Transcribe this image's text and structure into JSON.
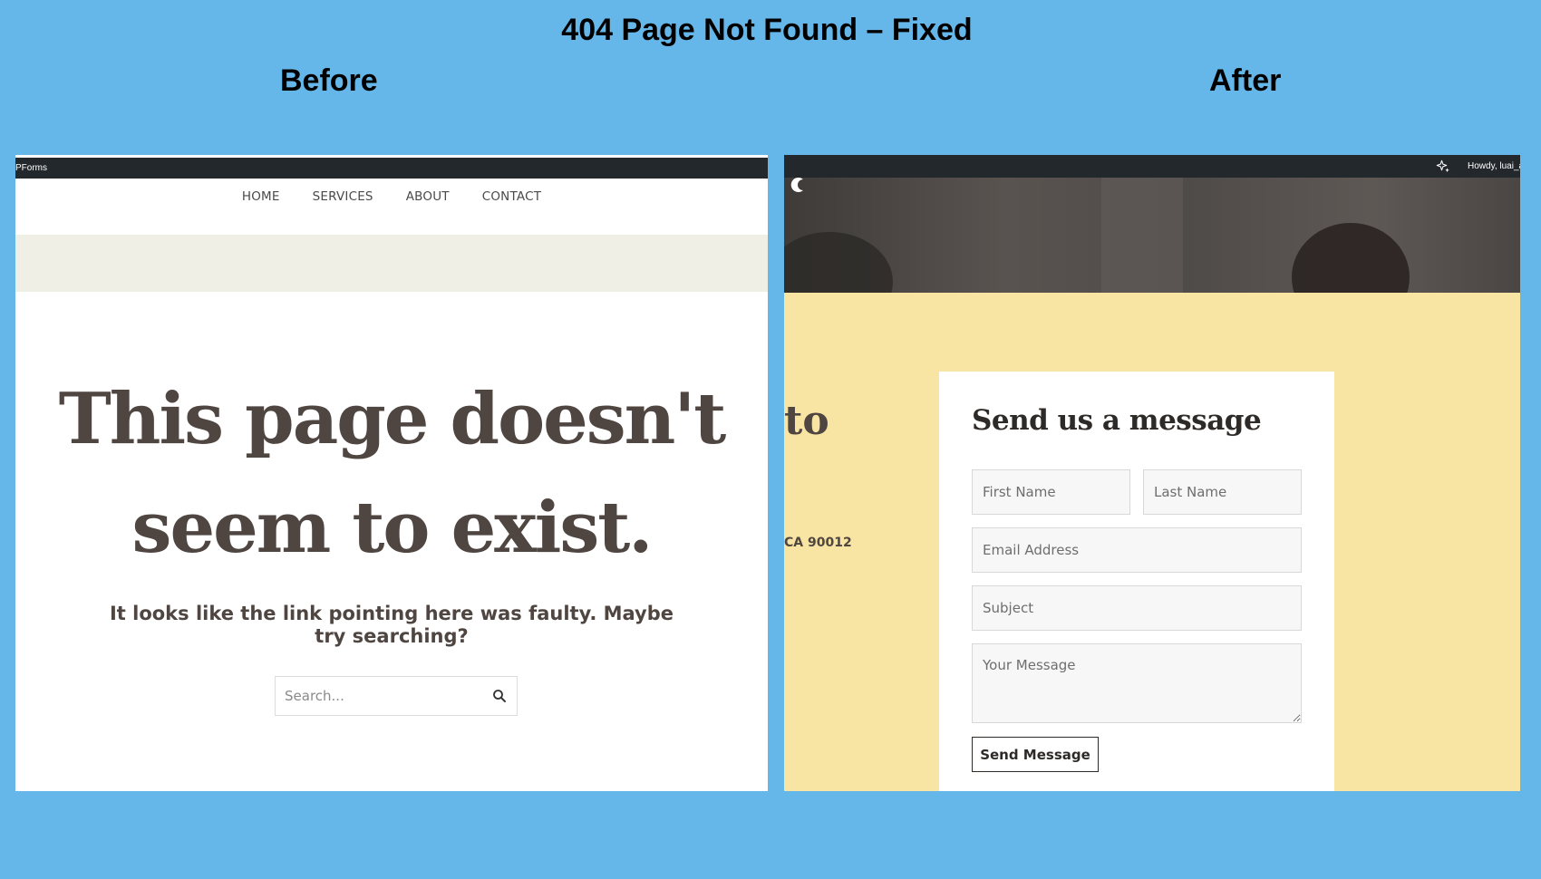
{
  "slide": {
    "title": "404 Page Not Found – Fixed",
    "before_label": "Before",
    "after_label": "After"
  },
  "before": {
    "admin_bar_text": "PForms",
    "nav": [
      "HOME",
      "SERVICES",
      "ABOUT",
      "CONTACT"
    ],
    "headline_line1": "This page doesn't",
    "headline_line2": "seem to exist.",
    "subtext": "It looks like the link pointing here was faulty. Maybe try searching?",
    "search_placeholder": "Search...",
    "search_icon": "search-icon"
  },
  "after": {
    "admin_bar_text": "Howdy, luai_a",
    "sparkle_icon": "sparkle-icon",
    "cut_heading": "to",
    "cut_address": "CA 90012",
    "form": {
      "title": "Send us a message",
      "first_name_placeholder": "First Name",
      "last_name_placeholder": "Last Name",
      "email_placeholder": "Email Address",
      "subject_placeholder": "Subject",
      "message_placeholder": "Your Message",
      "submit_label": "Send Message"
    }
  },
  "colors": {
    "background": "#66b7e9",
    "admin_bar": "#23282d",
    "hero_strip": "#f0efe6",
    "text_dark": "#4f4642",
    "after_background": "#f9e5a3"
  }
}
